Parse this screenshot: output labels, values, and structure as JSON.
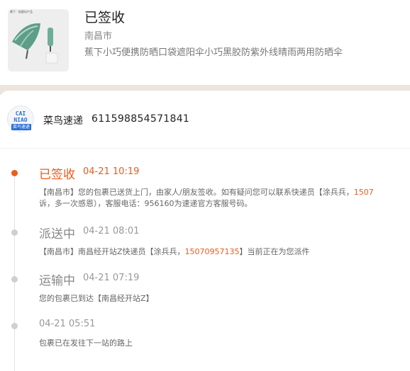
{
  "product": {
    "status": "已签收",
    "city": "南昌市",
    "title": "蕉下小巧便携防晒口袋遮阳伞小巧黑胶防紫外线晴雨两用防晒伞",
    "thumb_caption": "蕉下 · 轻量化产品"
  },
  "courier": {
    "logo_top": "CAI NIAO",
    "logo_bottom": "菜鸟速递",
    "name": "菜鸟速递",
    "tracking_no": "611598854571841"
  },
  "events": [
    {
      "status": "已签收",
      "time": "04-21 10:19",
      "desc_line1_a": "【南昌市】您的包裹已送货上门，由家人/朋友签收。如有疑问您可以联系快递员【涂兵兵，",
      "desc_line1_phone": "1507",
      "desc_line2": "诉，多一次感恩），客服电话：956160为速递官方客服号码。"
    },
    {
      "status": "派送中",
      "time": "04-21 08:01",
      "desc_a": "【南昌市】南昌经开站Z快递员【涂兵兵，",
      "desc_phone": "15070957135",
      "desc_b": "】当前正在为您派件"
    },
    {
      "status": "运输中",
      "time": "04-21 07:19",
      "desc": "您的包裹已到达【南昌经开站Z】"
    },
    {
      "status": "",
      "time": "04-21 05:51",
      "desc": "包裹已在发往下一站的路上"
    }
  ],
  "colors": {
    "accent": "#f05a1a",
    "band": "#ece4dd"
  }
}
